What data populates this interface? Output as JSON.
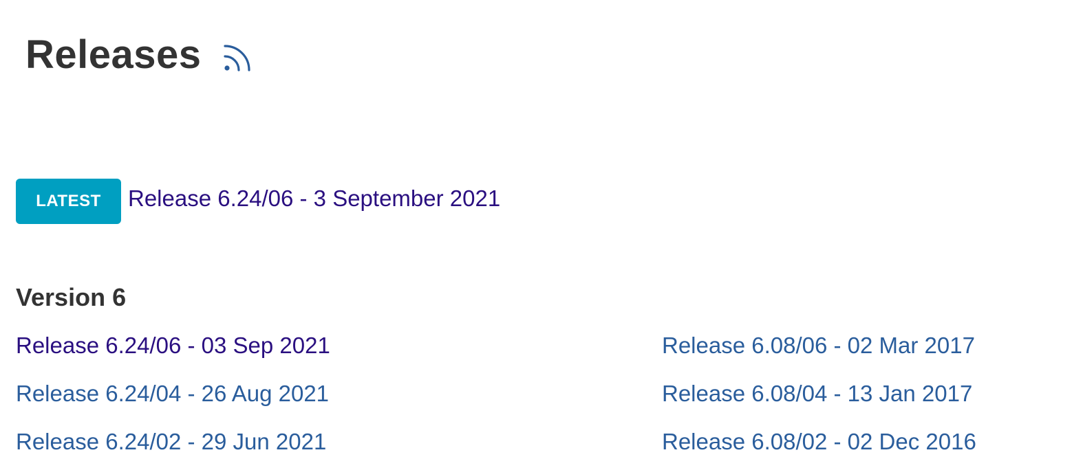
{
  "page": {
    "title": "Releases",
    "rss_icon": "rss-feed-icon"
  },
  "latest": {
    "badge": "LATEST",
    "link": "Release 6.24/06 - 3 September 2021"
  },
  "section": {
    "heading": "Version 6",
    "left_releases": [
      {
        "label": "Release 6.24/06 - 03 Sep 2021",
        "visited": true
      },
      {
        "label": "Release 6.24/04 - 26 Aug 2021",
        "visited": false
      },
      {
        "label": "Release 6.24/02 - 29 Jun 2021",
        "visited": false
      }
    ],
    "right_releases": [
      {
        "label": "Release 6.08/06 - 02 Mar 2017",
        "visited": false
      },
      {
        "label": "Release 6.08/04 - 13 Jan 2017",
        "visited": false
      },
      {
        "label": "Release 6.08/02 - 02 Dec 2016",
        "visited": false
      }
    ]
  },
  "colors": {
    "link": "#2a5d9c",
    "visited_link": "#2a0f80",
    "badge_bg": "#009fc1",
    "heading": "#333333",
    "rss_icon": "#2a5d9c"
  }
}
